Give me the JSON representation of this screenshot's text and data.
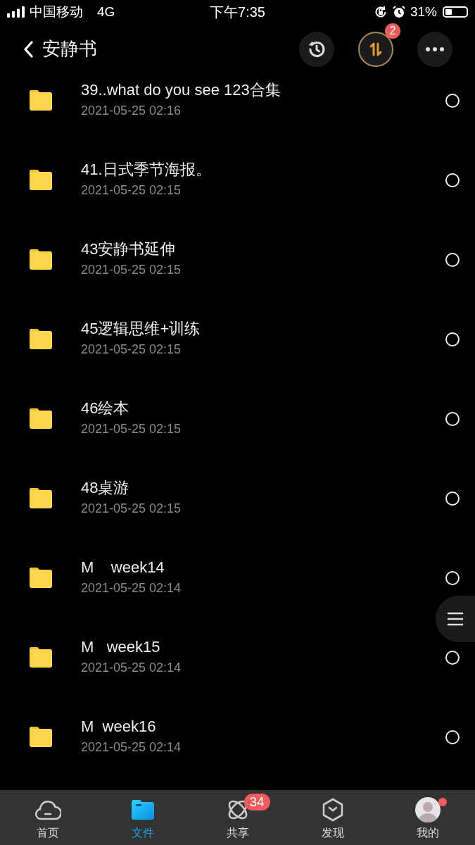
{
  "status_bar": {
    "carrier": "中国移动",
    "network": "4G",
    "time": "下午7:35",
    "battery": "31%"
  },
  "header": {
    "back_label": "安静书",
    "transfer_badge": "2"
  },
  "files": [
    {
      "name": "39..what do you see 123合集",
      "date": "2021-05-25 02:16",
      "selected": false
    },
    {
      "name": "41.日式季节海报。",
      "date": "2021-05-25 02:15",
      "selected": false
    },
    {
      "name": "43安静书延伸",
      "date": "2021-05-25 02:15",
      "selected": false
    },
    {
      "name": "45逻辑思维+训练",
      "date": "2021-05-25 02:15",
      "selected": false
    },
    {
      "name": "46绘本",
      "date": "2021-05-25 02:15",
      "selected": false
    },
    {
      "name": "48桌游",
      "date": "2021-05-25 02:15",
      "selected": false
    },
    {
      "name": "M    week14",
      "date": "2021-05-25 02:14",
      "selected": false
    },
    {
      "name": "M   week15",
      "date": "2021-05-25 02:14",
      "selected": false
    },
    {
      "name": "M  week16",
      "date": "2021-05-25 02:14",
      "selected": false
    }
  ],
  "tab_bar": [
    {
      "kind": "home",
      "label": "首页",
      "selected": false
    },
    {
      "kind": "files",
      "label": "文件",
      "selected": true
    },
    {
      "kind": "share",
      "label": "共享",
      "selected": false,
      "badge": "34"
    },
    {
      "kind": "discover",
      "label": "发现",
      "selected": false
    },
    {
      "kind": "me",
      "label": "我的",
      "selected": false,
      "dot": true
    }
  ]
}
